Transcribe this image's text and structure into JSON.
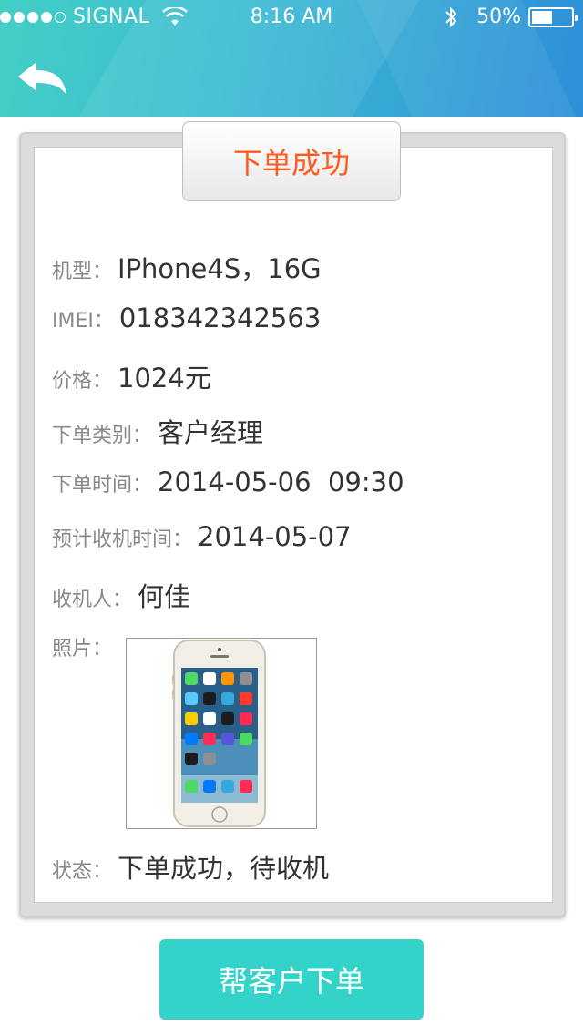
{
  "status_bar": {
    "carrier": "SIGNAL",
    "time": "8:16 AM",
    "battery_percent": "50%",
    "battery_level": 0.5,
    "signal_bars": 4
  },
  "header": {
    "back_icon": "back-arrow-icon",
    "gradient_colors": [
      "#43cfc6",
      "#2e8fd8"
    ]
  },
  "order": {
    "title": "下单成功",
    "title_color": "#ff5a1f",
    "fields": {
      "model_label": "机型：",
      "model_value": "IPhone4S，16G",
      "imei_label": "IMEI：",
      "imei_value": "018342342563",
      "price_label": "价格：",
      "price_value": "1024元",
      "type_label": "下单类别：",
      "type_value": "客户经理",
      "order_time_label": "下单时间：",
      "order_time_value": "2014-05-06  09:30",
      "pickup_time_label": "预计收机时间：",
      "pickup_time_value": "2014-05-07",
      "receiver_label": "收机人：",
      "receiver_value": "何佳",
      "photo_label": "照片：",
      "status_label": "状态：",
      "status_value": "下单成功，待收机"
    }
  },
  "actions": {
    "primary_label": "帮客户下单",
    "primary_color": "#34d3c9"
  }
}
